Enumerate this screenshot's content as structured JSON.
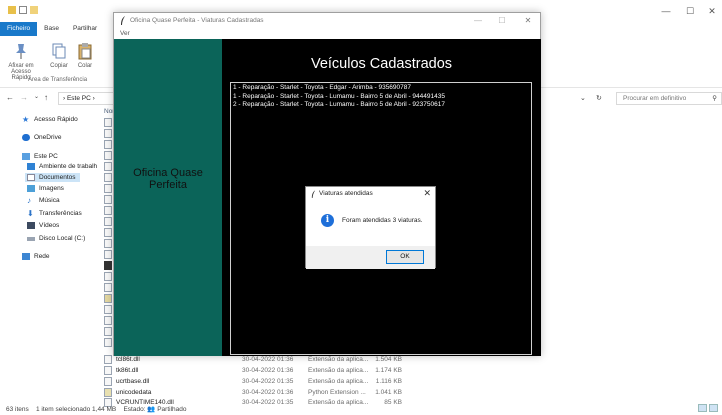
{
  "explorer": {
    "window_controls": [
      "—",
      "☐",
      "✕"
    ],
    "ribbon_tabs": [
      "Ficheiro",
      "Base",
      "Partilhar"
    ],
    "ribbon_buttons": [
      "Afixar em Acesso Rápido",
      "Copiar",
      "Colar"
    ],
    "ribbon_group": "Área de Transferência",
    "address": "› Este PC ›",
    "search_placeholder": "Procurar em definitivo",
    "name_column_partial": "Nom",
    "nav": {
      "acesso_rapido": "Acesso Rápido",
      "onedrive": "OneDrive",
      "este_pc": "Este PC",
      "ambiente": "Ambiente de trabalh",
      "documentos": "Documentos",
      "imagens": "Imagens",
      "musica": "Música",
      "transferencias": "Transferências",
      "videos": "Vídeos",
      "disco_local": "Disco Local (C:)",
      "rede": "Rede"
    },
    "files": [
      {
        "name": "tcl86t.dll",
        "date": "30-04-2022 01:36",
        "type": "Extensão da aplica...",
        "size": "1.504 KB"
      },
      {
        "name": "tk86t.dll",
        "date": "30-04-2022 01:36",
        "type": "Extensão da aplica...",
        "size": "1.174 KB"
      },
      {
        "name": "ucrtbase.dll",
        "date": "30-04-2022 01:35",
        "type": "Extensão da aplica...",
        "size": "1.116 KB"
      },
      {
        "name": "unicodedata",
        "date": "30-04-2022 01:36",
        "type": "Python Extension ...",
        "size": "1.041 KB"
      },
      {
        "name": "VCRUNTIME140.dll",
        "date": "30-04-2022 01:35",
        "type": "Extensão da aplica...",
        "size": "85 KB"
      }
    ],
    "status": {
      "count": "63 itens",
      "selection": "1 item selecionado 1,44 MB",
      "state": "Estado: 👥 Partilhado"
    }
  },
  "app": {
    "window_title": "Oficina Quase Perfeita - Viaturas Cadastradas",
    "menu_partial": "Ver",
    "window_controls": [
      "—",
      "☐",
      "✕"
    ],
    "sidebar_title": "Oficina Quase Perfeita",
    "main_title": "Veículos Cadastrados",
    "records": [
      "1 - Reparação - Starlet - Toyota - Edgar - Arimba - 935690787",
      "1 - Reparação - Starlet - Toyota - Lumamu - Bairro 5 de Abril - 944491435",
      "2 - Reparação - Starlet - Toyota - Lumamu - Bairro 5 de Abril - 923750617"
    ],
    "colors": {
      "sidebar": "#0b6459",
      "main_bg": "#000000",
      "text": "#ffffff"
    }
  },
  "dialog": {
    "title": "Viaturas atendidas",
    "close": "✕",
    "icon": "info-icon",
    "message": "Foram atendidas 3 viaturas.",
    "ok_label": "OK"
  }
}
